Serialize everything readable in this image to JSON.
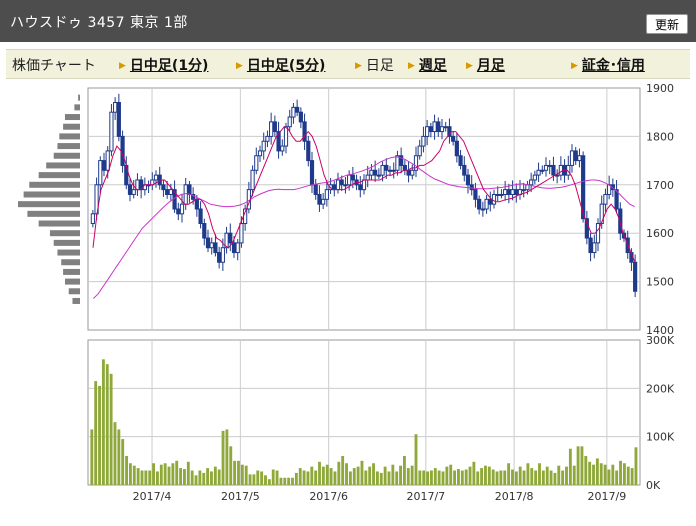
{
  "header": {
    "title": "ハウスドゥ 3457 東京 1部",
    "refresh_label": "更新"
  },
  "nav": {
    "lead": "株価チャート",
    "items": [
      {
        "label": "日中足(1分)",
        "link": true
      },
      {
        "label": "日中足(5分)",
        "link": true
      },
      {
        "label": "日足",
        "link": false
      },
      {
        "label": "週足",
        "link": true
      },
      {
        "label": "月足",
        "link": true
      },
      {
        "label": "証金･信用",
        "link": true
      }
    ]
  },
  "colors": {
    "candle": "#1f3a8a",
    "ma_short": "#cc0066",
    "ma_long": "#cc33cc",
    "volume": "#8fa83a",
    "volume_profile": "#808080",
    "grid": "#cccccc"
  },
  "chart_data": [
    {
      "type": "candlestick",
      "title": "",
      "ylim": [
        1400,
        1900
      ],
      "y_ticks": [
        "1900",
        "1800",
        "1700",
        "1600",
        "1500",
        "1400"
      ],
      "x_ticks": [
        "2017/4",
        "2017/5",
        "2017/6",
        "2017/7",
        "2017/8",
        "2017/9"
      ],
      "x_tick_index": [
        14,
        34,
        54,
        76,
        96,
        117
      ],
      "x_count": 125,
      "closes": [
        1640,
        1700,
        1750,
        1730,
        1770,
        1850,
        1870,
        1800,
        1740,
        1700,
        1680,
        1690,
        1710,
        1690,
        1700,
        1700,
        1710,
        1720,
        1700,
        1690,
        1680,
        1690,
        1650,
        1640,
        1660,
        1700,
        1680,
        1670,
        1650,
        1620,
        1590,
        1570,
        1580,
        1560,
        1540,
        1570,
        1600,
        1580,
        1560,
        1580,
        1620,
        1650,
        1690,
        1730,
        1760,
        1770,
        1790,
        1800,
        1830,
        1810,
        1770,
        1780,
        1820,
        1840,
        1860,
        1850,
        1830,
        1790,
        1750,
        1700,
        1680,
        1660,
        1670,
        1690,
        1700,
        1690,
        1710,
        1700,
        1700,
        1720,
        1710,
        1700,
        1690,
        1710,
        1720,
        1730,
        1720,
        1720,
        1740,
        1730,
        1730,
        1730,
        1760,
        1740,
        1730,
        1720,
        1730,
        1760,
        1780,
        1800,
        1820,
        1810,
        1830,
        1810,
        1820,
        1820,
        1800,
        1790,
        1760,
        1740,
        1720,
        1700,
        1690,
        1670,
        1650,
        1650,
        1670,
        1660,
        1680,
        1680,
        1680,
        1690,
        1680,
        1690,
        1680,
        1690,
        1690,
        1700,
        1710,
        1720,
        1730,
        1730,
        1740,
        1740,
        1720,
        1720,
        1740,
        1720,
        1740,
        1770,
        1750,
        1760,
        1630,
        1590,
        1560,
        1580,
        1620,
        1660,
        1680,
        1700,
        1690,
        1650,
        1600,
        1590,
        1560,
        1540,
        1480
      ],
      "ma_short": [
        1570,
        1640,
        1690,
        1710,
        1730,
        1760,
        1780,
        1770,
        1750,
        1720,
        1700,
        1690,
        1690,
        1700,
        1700,
        1700,
        1705,
        1710,
        1710,
        1700,
        1690,
        1680,
        1670,
        1660,
        1660,
        1665,
        1670,
        1670,
        1660,
        1640,
        1610,
        1590,
        1585,
        1575,
        1570,
        1580,
        1600,
        1620,
        1640,
        1660,
        1680,
        1700,
        1720,
        1740,
        1760,
        1780,
        1800,
        1810,
        1820,
        1815,
        1800,
        1790,
        1790,
        1800,
        1810,
        1800,
        1780,
        1750,
        1720,
        1700,
        1690,
        1690,
        1690,
        1690,
        1695,
        1700,
        1705,
        1705,
        1710,
        1710,
        1710,
        1710,
        1710,
        1715,
        1720,
        1720,
        1725,
        1725,
        1730,
        1730,
        1735,
        1735,
        1740,
        1740,
        1745,
        1750,
        1760,
        1770,
        1790,
        1800,
        1810,
        1810,
        1800,
        1790,
        1770,
        1750,
        1730,
        1710,
        1690,
        1680,
        1670,
        1665,
        1665,
        1668,
        1670,
        1672,
        1675,
        1680,
        1682,
        1685,
        1690,
        1695,
        1700,
        1705,
        1710,
        1715,
        1720,
        1725,
        1730,
        1730,
        1720,
        1700,
        1670,
        1640,
        1620,
        1600,
        1600,
        1610,
        1630,
        1650,
        1660,
        1650,
        1630,
        1600,
        1580,
        1560,
        1540
      ],
      "ma_long": [
        1465,
        1475,
        1490,
        1505,
        1520,
        1535,
        1550,
        1565,
        1580,
        1595,
        1610,
        1620,
        1630,
        1640,
        1650,
        1660,
        1668,
        1675,
        1680,
        1682,
        1680,
        1675,
        1670,
        1665,
        1660,
        1658,
        1656,
        1655,
        1655,
        1656,
        1658,
        1662,
        1668,
        1675,
        1680,
        1684,
        1688,
        1690,
        1691,
        1690,
        1690,
        1690,
        1692,
        1695,
        1698,
        1700,
        1702,
        1704,
        1705,
        1708,
        1712,
        1716,
        1720,
        1722,
        1725,
        1728,
        1732,
        1736,
        1742,
        1748,
        1752,
        1756,
        1758,
        1756,
        1752,
        1746,
        1740,
        1732,
        1725,
        1718,
        1712,
        1708,
        1704,
        1700,
        1698,
        1696,
        1695,
        1694,
        1693,
        1692,
        1692,
        1692,
        1693,
        1694,
        1695,
        1697,
        1699,
        1701,
        1702,
        1700,
        1698,
        1696,
        1694,
        1693,
        1693,
        1694,
        1695,
        1697,
        1700,
        1703,
        1706,
        1708,
        1710,
        1710,
        1708,
        1704,
        1698,
        1690,
        1680,
        1670,
        1660,
        1655
      ]
    },
    {
      "type": "bar",
      "title": "",
      "ylim": [
        0,
        300000
      ],
      "y_ticks": [
        "300K",
        "200K",
        "100K",
        "0K"
      ],
      "values": [
        115,
        215,
        205,
        260,
        250,
        230,
        130,
        115,
        95,
        60,
        45,
        40,
        35,
        30,
        30,
        30,
        45,
        28,
        42,
        45,
        38,
        45,
        50,
        35,
        33,
        48,
        30,
        20,
        30,
        25,
        35,
        28,
        38,
        32,
        112,
        115,
        80,
        50,
        50,
        42,
        40,
        22,
        22,
        30,
        28,
        20,
        12,
        32,
        30,
        15,
        15,
        15,
        15,
        25,
        35,
        30,
        28,
        38,
        30,
        48,
        38,
        42,
        35,
        28,
        48,
        60,
        45,
        28,
        35,
        38,
        50,
        30,
        38,
        45,
        28,
        25,
        38,
        28,
        42,
        28,
        40,
        60,
        35,
        40,
        105,
        30,
        30,
        28,
        30,
        35,
        30,
        28,
        38,
        42,
        30,
        33,
        30,
        32,
        38,
        48,
        28,
        35,
        40,
        38,
        32,
        28,
        30,
        30,
        45,
        32,
        28,
        38,
        30,
        45,
        35,
        30,
        45,
        30,
        38,
        30,
        25,
        40,
        30,
        38,
        75,
        40,
        80,
        80,
        60,
        48,
        42,
        55,
        45,
        42,
        32,
        42,
        30,
        50,
        45,
        38,
        35,
        78
      ],
      "unit_note": "values in thousands"
    },
    {
      "type": "bar",
      "title": "",
      "orientation": "horizontal",
      "bins": [
        1880,
        1870,
        1860,
        1850,
        1840,
        1830,
        1820,
        1810,
        1800,
        1790,
        1780,
        1770,
        1760,
        1750,
        1740,
        1730,
        1720,
        1710,
        1700,
        1690,
        1680,
        1670,
        1660,
        1650,
        1640,
        1630,
        1620,
        1610,
        1600,
        1590,
        1580,
        1570,
        1560,
        1550,
        1540,
        1530,
        1520,
        1510,
        1500,
        1490,
        1480,
        1470,
        1460,
        1450
      ],
      "values": [
        1,
        0,
        3,
        0,
        8,
        0,
        9,
        0,
        11,
        0,
        12,
        0,
        14,
        0,
        18,
        0,
        22,
        0,
        27,
        0,
        30,
        0,
        33,
        0,
        28,
        0,
        22,
        0,
        16,
        0,
        14,
        0,
        12,
        0,
        10,
        0,
        9,
        0,
        8,
        0,
        6,
        0,
        4,
        0
      ]
    }
  ]
}
